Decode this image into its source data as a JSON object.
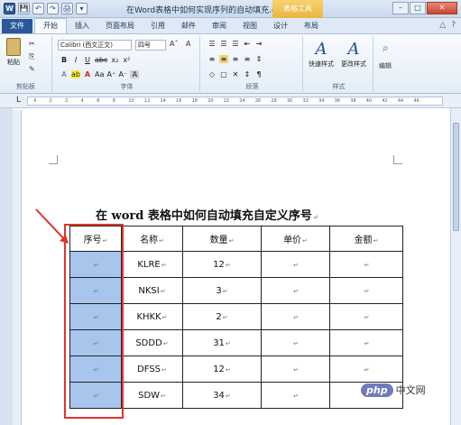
{
  "window": {
    "doc_title": "在Word表格中如何实现序列的自动填充.docx M...",
    "tool_tab": "表格工具",
    "min_label": "–",
    "max_label": "□",
    "close_label": "✕"
  },
  "quick_access": [
    "W",
    "💾",
    "↶",
    "↷",
    "🖨",
    "▾"
  ],
  "tabs": [
    "文件",
    "开始",
    "插入",
    "页面布局",
    "引用",
    "邮件",
    "审阅",
    "视图",
    "设计",
    "布局"
  ],
  "active_tab": "开始",
  "ribbon": {
    "clipboard": {
      "paste": "粘贴",
      "label": "剪贴板"
    },
    "font": {
      "name": "Calibri (西文正文)",
      "size": "四号",
      "label": "字体",
      "row2": [
        "B",
        "I",
        "U",
        "abc",
        "x₂",
        "x²"
      ],
      "row3": [
        "A",
        "ab",
        "A",
        "Aa",
        "A⁺",
        "A⁻",
        "A"
      ]
    },
    "paragraph": {
      "label": "段落",
      "row1": [
        "☰",
        "☰",
        "☰",
        "⇤",
        "⇥"
      ],
      "row2": [
        "≡",
        "≡",
        "≡",
        "≡",
        "⇕"
      ],
      "row3": [
        "◇",
        "▢",
        "✕",
        "↕",
        "¶"
      ]
    },
    "styles": {
      "quick": "快速样式",
      "change": "更改样式",
      "label": "样式"
    },
    "editing": {
      "label": "编辑"
    }
  },
  "ruler_ticks": [
    "4",
    "2",
    "2",
    "4",
    "6",
    "8",
    "10",
    "12",
    "14",
    "16",
    "18",
    "20",
    "22",
    "24",
    "26",
    "28",
    "30",
    "32",
    "34",
    "36",
    "38",
    "40",
    "42",
    "44",
    "46"
  ],
  "document": {
    "heading": "在 word 表格中如何自动填充自定义序号",
    "para_mark": "↵",
    "columns": [
      "序号",
      "名称",
      "数量",
      "单价",
      "金额"
    ],
    "rows": [
      {
        "name": "KLRE",
        "qty": "12"
      },
      {
        "name": "NKSI",
        "qty": "3"
      },
      {
        "name": "KHKK",
        "qty": "2"
      },
      {
        "name": "SDDD",
        "qty": "31"
      },
      {
        "name": "DFSS",
        "qty": "12"
      },
      {
        "name": "SDW",
        "qty": "34"
      }
    ]
  },
  "watermark": {
    "logo": "php",
    "text": "中文网"
  },
  "colors": {
    "file_tab": "#2b579a",
    "tool_tab": "#eab440",
    "selection": "#a8c5ec",
    "annotation": "#e0342c"
  }
}
